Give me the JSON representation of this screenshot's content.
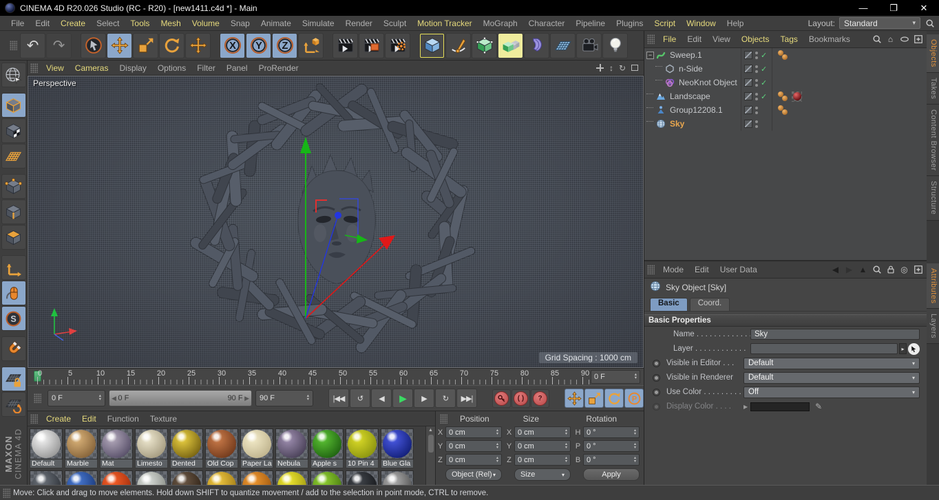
{
  "window": {
    "title": "CINEMA 4D R20.026 Studio (RC - R20) - [new1411.c4d *] - Main",
    "controls": {
      "minimize": "—",
      "restore": "❐",
      "close": "✕"
    }
  },
  "menubar": {
    "items": [
      {
        "label": "File",
        "hl": false
      },
      {
        "label": "Edit",
        "hl": false
      },
      {
        "label": "Create",
        "hl": true
      },
      {
        "label": "Select",
        "hl": false
      },
      {
        "label": "Tools",
        "hl": true
      },
      {
        "label": "Mesh",
        "hl": true
      },
      {
        "label": "Volume",
        "hl": true
      },
      {
        "label": "Snap",
        "hl": false
      },
      {
        "label": "Animate",
        "hl": false
      },
      {
        "label": "Simulate",
        "hl": false
      },
      {
        "label": "Render",
        "hl": false
      },
      {
        "label": "Sculpt",
        "hl": false
      },
      {
        "label": "Motion Tracker",
        "hl": true
      },
      {
        "label": "MoGraph",
        "hl": false
      },
      {
        "label": "Character",
        "hl": false
      },
      {
        "label": "Pipeline",
        "hl": false
      },
      {
        "label": "Plugins",
        "hl": false
      },
      {
        "label": "Script",
        "hl": true
      },
      {
        "label": "Window",
        "hl": true
      },
      {
        "label": "Help",
        "hl": false
      }
    ],
    "layout_label": "Layout:",
    "layout_value": "Standard"
  },
  "toolbar": {
    "tools": [
      {
        "name": "undo",
        "icon": "undo"
      },
      {
        "name": "redo",
        "icon": "redo",
        "disabled": true
      },
      {
        "sep": true
      },
      {
        "name": "live-selection",
        "icon": "cursor"
      },
      {
        "name": "move",
        "icon": "move",
        "active": true
      },
      {
        "name": "scale",
        "icon": "scale"
      },
      {
        "name": "rotate",
        "icon": "rotate"
      },
      {
        "name": "last-used-tool",
        "icon": "move"
      },
      {
        "sep": true
      },
      {
        "name": "lock-x-axis",
        "icon": "ring-letter",
        "letter": "X",
        "active": true
      },
      {
        "name": "lock-y-axis",
        "icon": "ring-letter",
        "letter": "Y",
        "active": true
      },
      {
        "name": "lock-z-axis",
        "icon": "ring-letter",
        "letter": "Z",
        "active": true
      },
      {
        "name": "coordinate-system",
        "icon": "axis-cube"
      },
      {
        "sep": true
      },
      {
        "name": "render-view",
        "icon": "clapper"
      },
      {
        "name": "render-to-picture-viewer",
        "icon": "clapper-pv"
      },
      {
        "name": "edit-render-settings",
        "icon": "clapper-gear"
      },
      {
        "sep": true
      },
      {
        "name": "add-cube-primitive",
        "icon": "cube-blue",
        "frame": "yellow"
      },
      {
        "name": "spline-pen",
        "icon": "pen"
      },
      {
        "name": "subdivision-surface",
        "icon": "cube-green"
      },
      {
        "name": "add-instance",
        "icon": "cube-cascade",
        "highlight": true
      },
      {
        "name": "add-deformer",
        "icon": "bend"
      },
      {
        "name": "add-floor",
        "icon": "floor"
      },
      {
        "name": "add-camera",
        "icon": "camera"
      },
      {
        "name": "add-light",
        "icon": "bulb"
      }
    ],
    "rail": [
      {
        "name": "convert-to-editable",
        "icon": "globe"
      },
      {
        "gap": true
      },
      {
        "name": "model-mode",
        "icon": "cube-model",
        "active": true
      },
      {
        "name": "texture-mode",
        "icon": "cube-texture"
      },
      {
        "name": "workplane-mode",
        "icon": "workplane"
      },
      {
        "gap": true
      },
      {
        "name": "points-mode",
        "icon": "cube-points"
      },
      {
        "name": "edges-mode",
        "icon": "cube-edges"
      },
      {
        "name": "polygons-mode",
        "icon": "cube-polys"
      },
      {
        "gap": true
      },
      {
        "name": "enable-axis-modification",
        "icon": "axis"
      },
      {
        "name": "tweak-mode",
        "icon": "mouse",
        "active": true
      },
      {
        "name": "soft-selection",
        "icon": "scircle",
        "active": true
      },
      {
        "gap": true
      },
      {
        "name": "enable-snap",
        "icon": "magnet"
      },
      {
        "gap": true
      },
      {
        "name": "lock-workplane",
        "icon": "plane-lock",
        "active": true
      },
      {
        "name": "align-workplane",
        "icon": "plane-rot"
      }
    ]
  },
  "brand": {
    "line1": "MAXON",
    "line2": "CINEMA 4D"
  },
  "viewport": {
    "menu": [
      {
        "label": "View",
        "hl": true
      },
      {
        "label": "Cameras",
        "hl": true
      },
      {
        "label": "Display",
        "hl": false
      },
      {
        "label": "Options",
        "hl": false
      },
      {
        "label": "Filter",
        "hl": false
      },
      {
        "label": "Panel",
        "hl": false
      },
      {
        "label": "ProRender",
        "hl": false
      }
    ],
    "camera_label": "Perspective",
    "grid_spacing_label": "Grid Spacing : 1000 cm"
  },
  "timeline": {
    "labels": [
      "0",
      "5",
      "10",
      "15",
      "20",
      "25",
      "30",
      "35",
      "40",
      "45",
      "50",
      "55",
      "60",
      "65",
      "70",
      "75",
      "80",
      "85",
      "90"
    ],
    "frame_spinner": "0 F"
  },
  "transport": {
    "current_frame": "0 F",
    "range_start": "0 F",
    "range_end": "90 F",
    "end_frame": "90 F",
    "buttons": [
      {
        "name": "go-to-start",
        "glyph": "|◀◀"
      },
      {
        "name": "go-to-previous-key",
        "glyph": "↺"
      },
      {
        "name": "go-to-previous-frame",
        "glyph": "◀"
      },
      {
        "name": "play-forwards",
        "glyph": "▶",
        "accent": true
      },
      {
        "name": "go-to-next-frame",
        "glyph": "▶"
      },
      {
        "name": "go-to-next-key",
        "glyph": "↻"
      },
      {
        "name": "go-to-end",
        "glyph": "▶▶|"
      }
    ],
    "record_buttons": [
      {
        "name": "record-active-objects",
        "icon": "key"
      },
      {
        "name": "autokeying",
        "glyph": "( )"
      },
      {
        "name": "keyframe-selection",
        "glyph": "?"
      }
    ],
    "keyframe_toggles": [
      {
        "name": "keyframe-position",
        "icon": "move"
      },
      {
        "name": "keyframe-scale",
        "icon": "scale"
      },
      {
        "name": "keyframe-rotation",
        "icon": "rotate"
      },
      {
        "name": "keyframe-parameter",
        "icon": "pcircle"
      },
      {
        "name": "keyframe-point-level",
        "icon": "dots9"
      }
    ]
  },
  "materials": {
    "menu": [
      {
        "label": "Create",
        "hl": true
      },
      {
        "label": "Edit",
        "hl": true
      },
      {
        "label": "Function",
        "hl": false
      },
      {
        "label": "Texture",
        "hl": false
      }
    ],
    "items": [
      {
        "name": "Default",
        "c1": "#f4f4f4",
        "c2": "#8e8e8e"
      },
      {
        "name": "Marble",
        "c1": "#dcb47a",
        "c2": "#7e5c34"
      },
      {
        "name": "Mat",
        "c1": "#b4aabc",
        "c2": "#504862"
      },
      {
        "name": "Limesto",
        "c1": "#f0ead2",
        "c2": "#9e9478"
      },
      {
        "name": "Dented",
        "c1": "#ecd242",
        "c2": "#6e5a0e"
      },
      {
        "name": "Old Cop",
        "c1": "#cc7c4a",
        "c2": "#6a3418"
      },
      {
        "name": "Paper La",
        "c1": "#f4ecca",
        "c2": "#baae88"
      },
      {
        "name": "Nebula",
        "c1": "#a090b2",
        "c2": "#423a50"
      },
      {
        "name": "Apple s",
        "c1": "#5cc434",
        "c2": "#1a5a0e"
      },
      {
        "name": "10 Pin 4",
        "c1": "#dcdc28",
        "c2": "#848e0e"
      },
      {
        "name": "Blue Gla",
        "c1": "#4a5ae6",
        "c2": "#0e1a6e"
      }
    ],
    "row2": [
      {
        "c1": "#6e747c",
        "c2": "#2a2e34"
      },
      {
        "c1": "#4a7ad4",
        "c2": "#163472"
      },
      {
        "c1": "#fa6028",
        "c2": "#9a2c0c"
      },
      {
        "c1": "#dce0dc",
        "c2": "#82867f"
      },
      {
        "c1": "#6e5a48",
        "c2": "#2c2014"
      },
      {
        "c1": "#f2ca42",
        "c2": "#9a7414"
      },
      {
        "c1": "#f29a32",
        "c2": "#9a540c"
      },
      {
        "c1": "#f2ea32",
        "c2": "#9a9410"
      },
      {
        "c1": "#92d232",
        "c2": "#44740e"
      },
      {
        "c1": "#42464c",
        "c2": "#141619"
      },
      {
        "c1": "#b4b4b4",
        "c2": "#4a4a4a"
      }
    ]
  },
  "coordinates": {
    "headers": [
      "Position",
      "Size",
      "Rotation"
    ],
    "groups": [
      {
        "title": "Position",
        "rows": [
          {
            "axis": "X",
            "value": "0 cm"
          },
          {
            "axis": "Y",
            "value": "0 cm"
          },
          {
            "axis": "Z",
            "value": "0 cm"
          }
        ],
        "footer": "Object (Rel)",
        "footer_type": "dropdown"
      },
      {
        "title": "Size",
        "rows": [
          {
            "axis": "X",
            "value": "0 cm"
          },
          {
            "axis": "Y",
            "value": "0 cm"
          },
          {
            "axis": "Z",
            "value": "0 cm"
          }
        ],
        "footer": "Size",
        "footer_type": "dropdown"
      },
      {
        "title": "Rotation",
        "rows": [
          {
            "axis": "H",
            "value": "0 °"
          },
          {
            "axis": "P",
            "value": "0 °"
          },
          {
            "axis": "B",
            "value": "0 °"
          }
        ],
        "footer": "Apply",
        "footer_type": "button"
      }
    ]
  },
  "object_manager": {
    "menu": [
      {
        "label": "File",
        "hl": true
      },
      {
        "label": "Edit",
        "hl": false
      },
      {
        "label": "View",
        "hl": false
      },
      {
        "label": "Objects",
        "hl": true
      },
      {
        "label": "Tags",
        "hl": true
      },
      {
        "label": "Bookmarks",
        "hl": false
      }
    ],
    "objects": [
      {
        "name": "Sweep.1",
        "depth": 0,
        "icon": "sweep",
        "expand": true,
        "check": true,
        "tags": [
          "orange",
          "orange"
        ],
        "selected": false
      },
      {
        "name": "n-Side",
        "depth": 1,
        "icon": "nside",
        "check": true,
        "tags": [],
        "selected": false
      },
      {
        "name": "NeoKnot Object",
        "depth": 1,
        "icon": "neoknot",
        "check": true,
        "tags": [],
        "selected": false
      },
      {
        "name": "Landscape",
        "depth": 0,
        "icon": "landscape",
        "check": true,
        "tags": [
          "orange",
          "orange",
          "texture"
        ],
        "selected": false
      },
      {
        "name": "Group12208.1",
        "depth": 0,
        "icon": "group",
        "check": false,
        "tags": [
          "orange",
          "orange"
        ],
        "selected": false
      },
      {
        "name": "Sky",
        "depth": 0,
        "icon": "sky",
        "check": false,
        "tags": [],
        "selected": true
      }
    ]
  },
  "attributes": {
    "menu": [
      {
        "label": "Mode",
        "hl": false
      },
      {
        "label": "Edit",
        "hl": false
      },
      {
        "label": "User Data",
        "hl": false
      }
    ],
    "object_title": "Sky Object [Sky]",
    "tabs": {
      "basic": "Basic",
      "coord": "Coord."
    },
    "section_title": "Basic Properties",
    "name_label": "Name . . . . . . . . . . . . .",
    "name_value": "Sky",
    "layer_label": "Layer . . . . . . . . . . . .",
    "rows": [
      {
        "name": "visible-in-editor",
        "label": "Visible in Editor . . .",
        "value": "Default"
      },
      {
        "name": "visible-in-renderer",
        "label": "Visible in Renderer",
        "value": "Default"
      },
      {
        "name": "use-color",
        "label": "Use Color . . . . . . . . .",
        "value": "Off"
      }
    ],
    "display_color_label": "Display Color . . . ."
  },
  "side_tabs": {
    "top": [
      {
        "label": "Objects",
        "active": true
      },
      {
        "label": "Takes",
        "active": false
      },
      {
        "label": "Content Browser",
        "active": false
      },
      {
        "label": "Structure",
        "active": false
      }
    ],
    "bottom": [
      {
        "label": "Attributes",
        "active": true
      },
      {
        "label": "Layers",
        "active": false
      }
    ]
  },
  "statusbar": {
    "text": "Move: Click and drag to move elements. Hold down SHIFT to quantize movement / add to the selection in point mode, CTRL to remove."
  }
}
